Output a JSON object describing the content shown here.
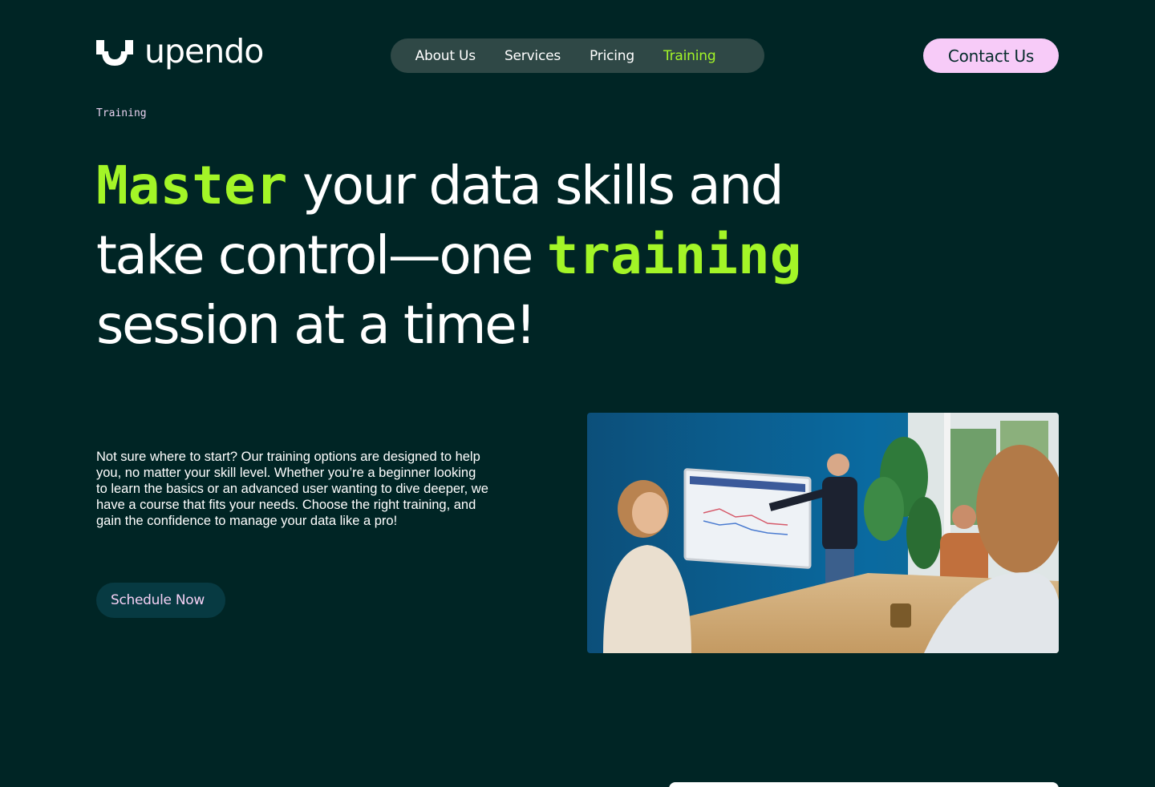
{
  "brand": {
    "name": "upendo"
  },
  "nav": {
    "items": [
      {
        "label": "About Us"
      },
      {
        "label": "Services"
      },
      {
        "label": "Pricing"
      },
      {
        "label": "Training"
      }
    ],
    "active_index": 3
  },
  "header": {
    "contact_label": "Contact Us"
  },
  "breadcrumb": "Training",
  "hero": {
    "line1_accent": "Master",
    "line1_rest": "your data skills and",
    "line2_start": "take control—one",
    "line2_accent": "training",
    "line3": "session at a time!",
    "description": "Not sure where to start? Our training options are designed to help you, no matter your skill level. Whether you’re a beginner looking to learn the basics or an advanced user wanting to dive deeper, we have a course that fits your needs. Choose the right training, and gain the confidence to manage your data like a pro!",
    "cta_label": "Schedule Now"
  },
  "colors": {
    "background": "#002525",
    "accent_green": "#a3f527",
    "accent_pink": "#f7cbf8",
    "nav_bg": "#2f4846"
  }
}
